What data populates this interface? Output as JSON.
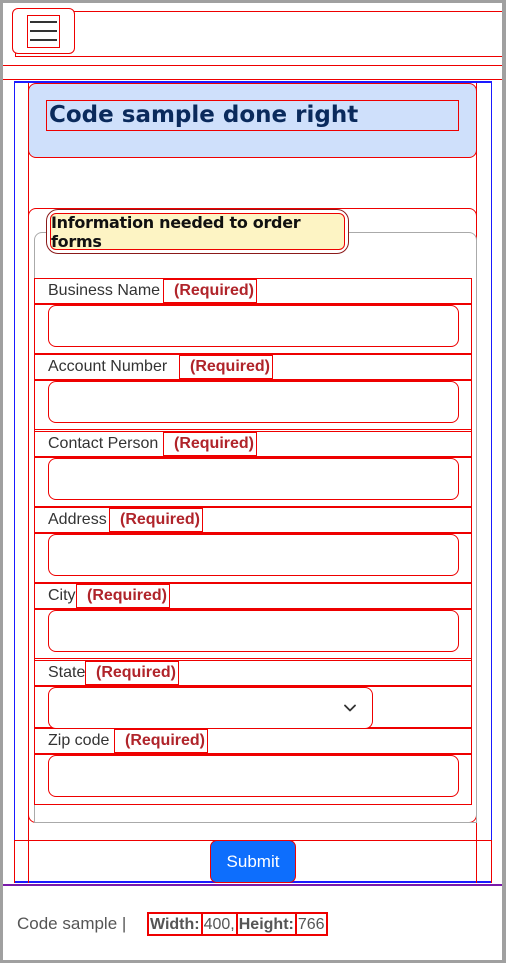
{
  "nav": {
    "menu_icon": "hamburger-menu-icon"
  },
  "page": {
    "title": "Code sample done right"
  },
  "form": {
    "legend": "Information needed to order forms",
    "required_text": "(Required)",
    "fields": [
      {
        "label": "Business Name",
        "value": ""
      },
      {
        "label": "Account Number",
        "value": ""
      },
      {
        "label": "Contact Person",
        "value": ""
      },
      {
        "label": "Address",
        "value": ""
      },
      {
        "label": "City",
        "value": ""
      },
      {
        "label": "State",
        "value": ""
      },
      {
        "label": "Zip code",
        "value": ""
      }
    ],
    "submit_label": "Submit"
  },
  "footer": {
    "text": "Code sample |",
    "width_label": "Width:",
    "width_value": "400,",
    "height_label": "Height:",
    "height_value": "766"
  },
  "colors": {
    "header_bg": "#cfe0fb",
    "legend_bg": "#fdf4c4",
    "required": "#b0242a",
    "submit": "#0d6efd"
  }
}
